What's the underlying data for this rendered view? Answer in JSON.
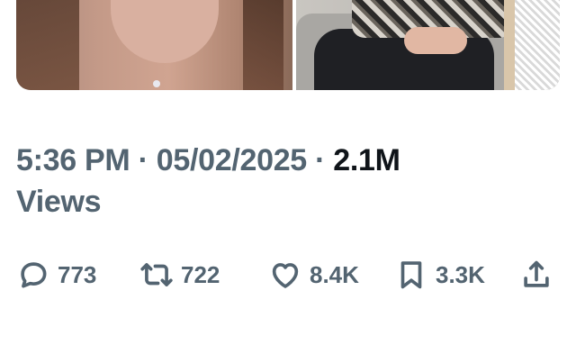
{
  "tweet": {
    "time": "5:36 PM",
    "separator": "·",
    "date": "05/02/2025",
    "views_count": "2.1M",
    "views_label": "Views"
  },
  "actions": {
    "replies": "773",
    "reposts": "722",
    "likes": "8.4K",
    "bookmarks": "3.3K"
  },
  "icons": {
    "reply": "comment-bubble-icon",
    "repost": "repost-arrows-icon",
    "like": "heart-icon",
    "bookmark": "bookmark-icon",
    "share": "share-upload-icon"
  },
  "colors": {
    "muted": "#536471",
    "primary_text": "#0f1419",
    "background": "#ffffff"
  }
}
